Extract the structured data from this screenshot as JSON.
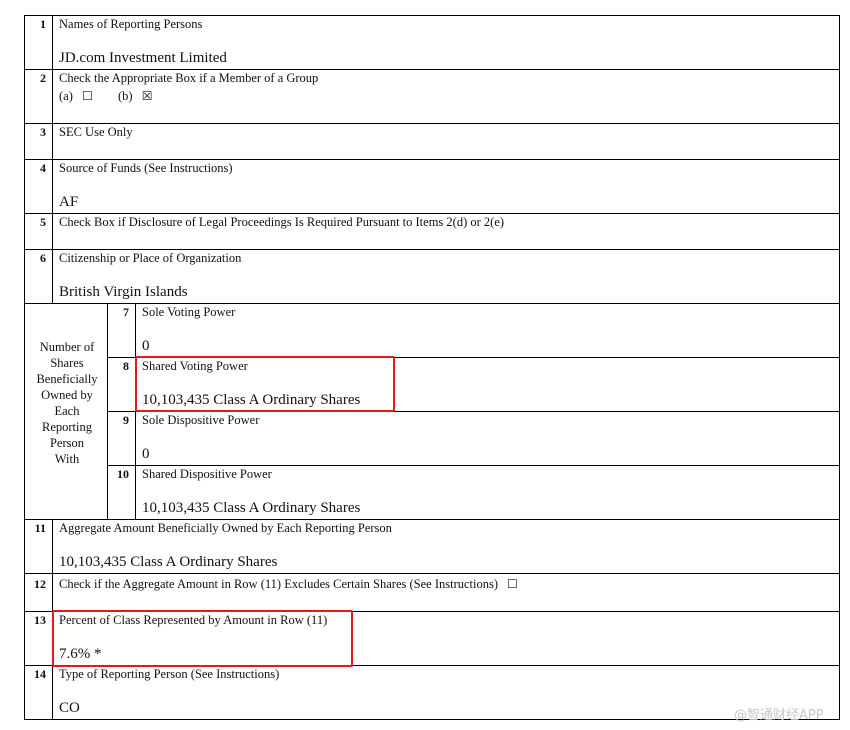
{
  "rows": {
    "r1": {
      "num": "1",
      "label": "Names of Reporting Persons",
      "value": "JD.com Investment Limited"
    },
    "r2": {
      "num": "2",
      "label": "Check the Appropriate Box if a Member of a Group",
      "a": "(a)",
      "a_box": "☐",
      "b": "(b)",
      "b_box": "☒"
    },
    "r3": {
      "num": "3",
      "label": "SEC Use Only"
    },
    "r4": {
      "num": "4",
      "label": "Source of Funds (See Instructions)",
      "value": "AF"
    },
    "r5": {
      "num": "5",
      "label": "Check Box if Disclosure of Legal Proceedings Is Required Pursuant to Items 2(d) or 2(e)"
    },
    "r6": {
      "num": "6",
      "label": "Citizenship or Place of Organization",
      "value": "British Virgin Islands"
    },
    "side_label": [
      "Number of",
      "Shares",
      "Beneficially",
      "Owned by",
      "Each",
      "Reporting",
      "Person",
      "With"
    ],
    "r7": {
      "num": "7",
      "label": "Sole Voting Power",
      "value": "0"
    },
    "r8": {
      "num": "8",
      "label": "Shared Voting Power",
      "value": "10,103,435 Class A Ordinary Shares"
    },
    "r9": {
      "num": "9",
      "label": "Sole Dispositive Power",
      "value": "0"
    },
    "r10": {
      "num": "10",
      "label": "Shared Dispositive Power",
      "value": "10,103,435 Class A Ordinary Shares"
    },
    "r11": {
      "num": "11",
      "label": "Aggregate Amount Beneficially Owned by Each Reporting Person",
      "value": "10,103,435 Class A Ordinary Shares"
    },
    "r12": {
      "num": "12",
      "label": "Check if the Aggregate Amount in Row (11) Excludes Certain Shares (See Instructions)",
      "box": "☐"
    },
    "r13": {
      "num": "13",
      "label": "Percent of Class Represented by Amount in Row (11)",
      "value": "7.6% *"
    },
    "r14": {
      "num": "14",
      "label": "Type of Reporting Person (See Instructions)",
      "value": "CO"
    }
  },
  "watermark": "@智通财经APP",
  "colors": {
    "highlight": "#e21a1a",
    "border": "#000000"
  }
}
